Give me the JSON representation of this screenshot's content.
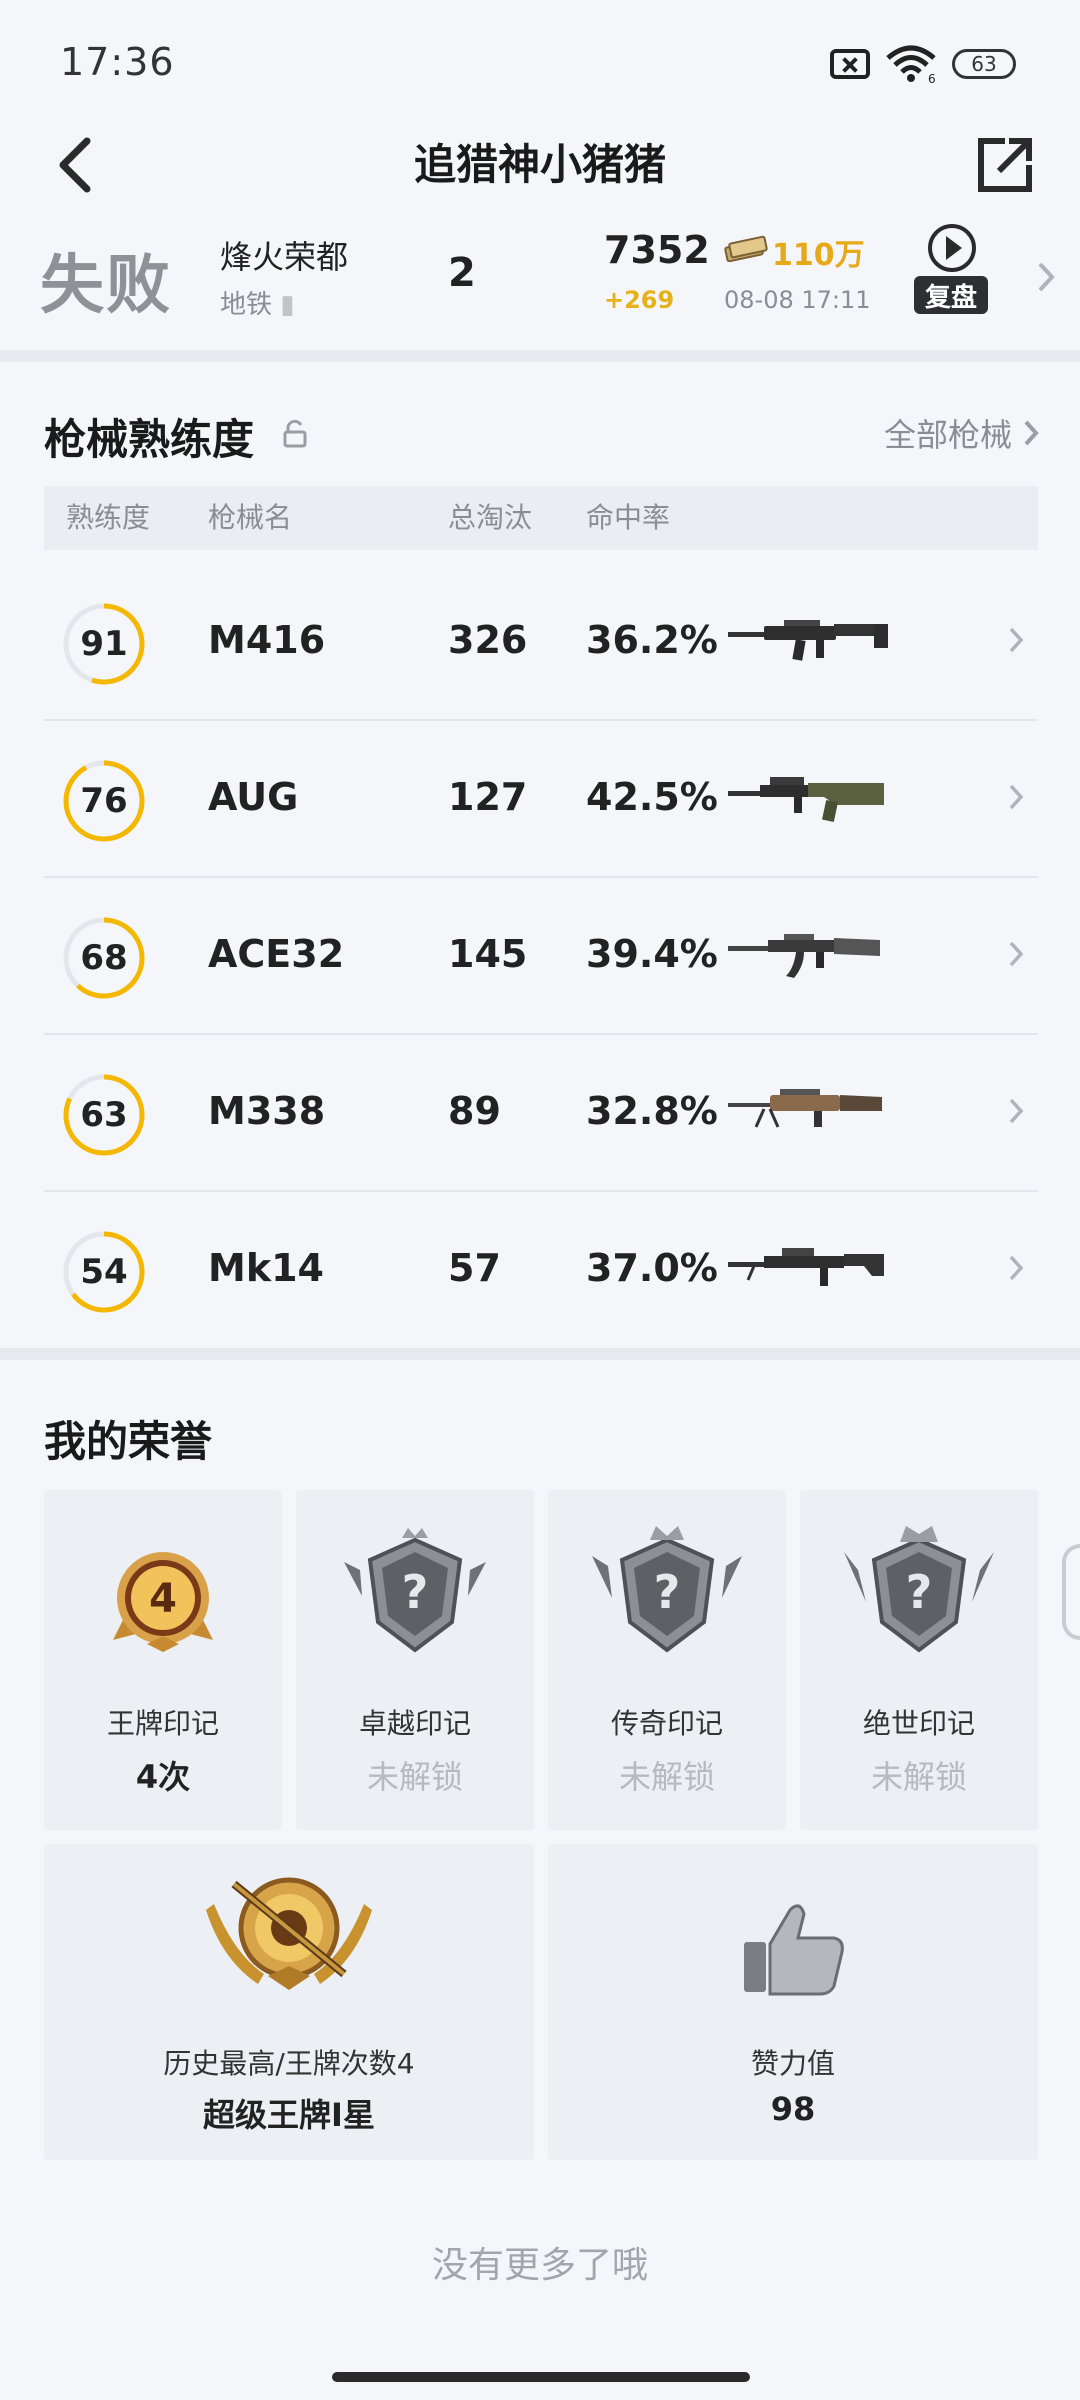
{
  "status": {
    "time": "17:36",
    "wifi_label": "6",
    "battery": "63"
  },
  "header": {
    "title": "追猎神小猪猪"
  },
  "match": {
    "result": "失败",
    "map": "烽火荣都",
    "mode": "地铁",
    "rank": "2",
    "score": "7352",
    "score_delta": "+269",
    "cash": "110万",
    "time": "08-08 17:11",
    "replay_label": "复盘"
  },
  "weapons": {
    "title": "枪械熟练度",
    "all_label": "全部枪械",
    "columns": [
      "熟练度",
      "枪械名",
      "总淘汰",
      "命中率"
    ],
    "rows": [
      {
        "proficiency": "91",
        "level": 0.55,
        "name": "M416",
        "kills": "326",
        "accuracy": "36.2%"
      },
      {
        "proficiency": "76",
        "level": 0.92,
        "name": "AUG",
        "kills": "127",
        "accuracy": "42.5%"
      },
      {
        "proficiency": "68",
        "level": 0.62,
        "name": "ACE32",
        "kills": "145",
        "accuracy": "39.4%"
      },
      {
        "proficiency": "63",
        "level": 0.82,
        "name": "M338",
        "kills": "89",
        "accuracy": "32.8%"
      },
      {
        "proficiency": "54",
        "level": 0.65,
        "name": "Mk14",
        "kills": "57",
        "accuracy": "37.0%"
      }
    ]
  },
  "honors": {
    "title": "我的荣誉",
    "marks": [
      {
        "label": "王牌印记",
        "value": "4次",
        "badge_number": "4",
        "locked": false
      },
      {
        "label": "卓越印记",
        "value": "未解锁",
        "locked": true
      },
      {
        "label": "传奇印记",
        "value": "未解锁",
        "locked": true
      },
      {
        "label": "绝世印记",
        "value": "未解锁",
        "locked": true
      }
    ],
    "best": {
      "label": "历史最高/王牌次数4",
      "value": "超级王牌Ⅰ星"
    },
    "likes": {
      "label": "赞力值",
      "value": "98"
    }
  },
  "footer": {
    "no_more": "没有更多了哦"
  },
  "colors": {
    "accent": "#f5b800",
    "ring_track": "#e3e6ea",
    "page_bg": "#f4f6fa",
    "card_bg": "#eceff3"
  }
}
